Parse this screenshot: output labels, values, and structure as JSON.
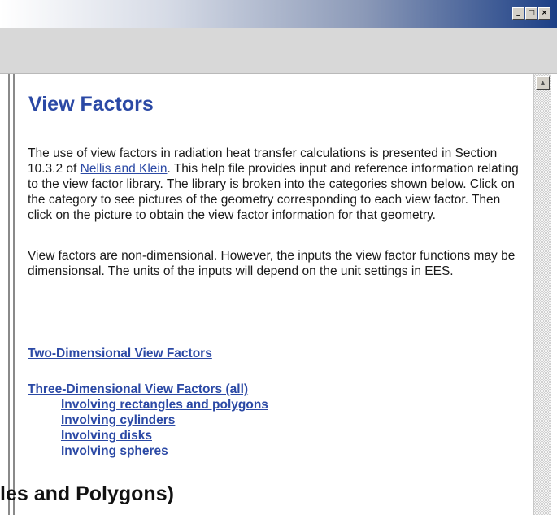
{
  "window": {
    "buttons": [
      {
        "name": "minimize-button",
        "glyph": "_"
      },
      {
        "name": "maximize-button",
        "glyph": "□"
      },
      {
        "name": "close-button",
        "glyph": "×"
      }
    ]
  },
  "scrollbar": {
    "up_arrow_icon": "▲"
  },
  "main": {
    "title": "View Factors",
    "paragraph1_part1": "The use of view factors in radiation heat transfer calculations is presented in Section 10.3.2 of ",
    "paragraph1_link": "Nellis and Klein",
    "paragraph1_part2": ".  This help file provides input and reference information relating to the view factor library.  The library is broken into the categories shown below.  Click on the category to see pictures of the geometry corresponding to each view factor.  Then click on the picture to obtain the view factor information for that geometry.",
    "paragraph2": "View factors are non-dimensional.  However, the inputs the view factor functions may be dimensionsal.  The units of the inputs will depend on the unit settings in EES.",
    "links": {
      "two_dim": "Two-Dimensional View Factors",
      "three_dim": "Three-Dimensional View Factors (all)",
      "sub": [
        "Involving rectangles and polygons",
        "Involving cylinders",
        "Involving disks",
        "Involving spheres"
      ]
    }
  },
  "background_caption": "les and Polygons)"
}
